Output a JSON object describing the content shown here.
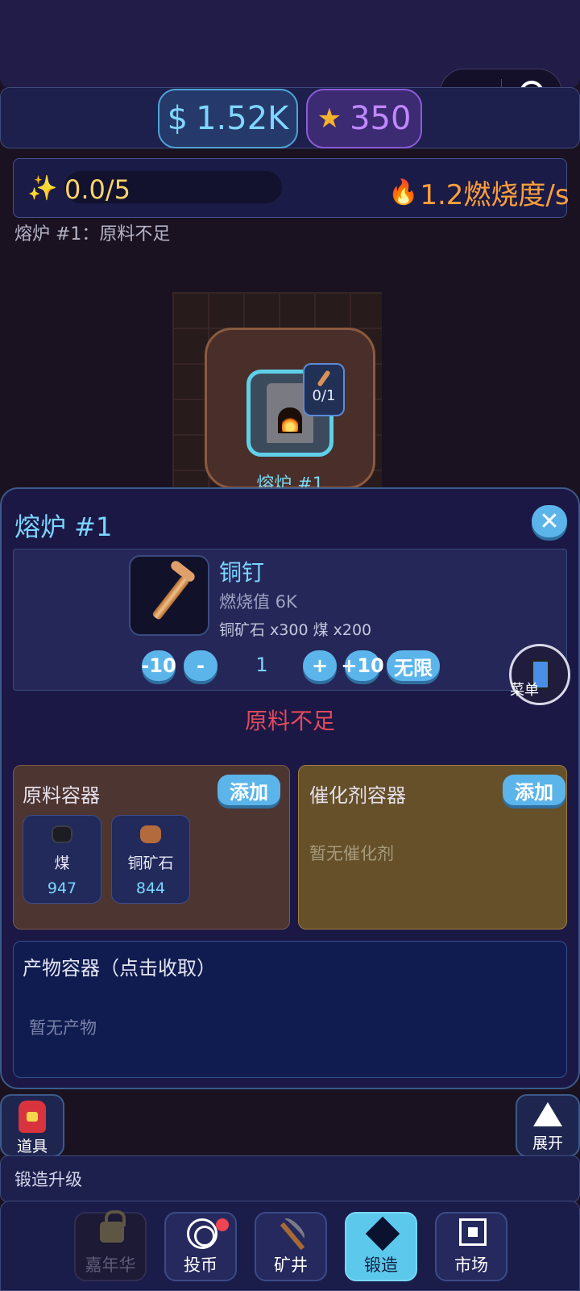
{
  "header": {
    "money": "1.52K",
    "money_symbol": "$",
    "stars": "350",
    "capsule_more": "•••"
  },
  "progress": {
    "value_text": "0.0/5",
    "fraction": 0.0,
    "burn_rate": "1.2燃烧度/s"
  },
  "status_text": "熔炉 #1：原料不足",
  "scene": {
    "furnace_label": "熔炉 #1",
    "mini_slot_count": "0/1"
  },
  "panel": {
    "title": "熔炉 #1",
    "close_label": "✕",
    "recipe": {
      "name": "铜钉",
      "burn_value": "燃烧值 6K",
      "cost": "铜矿石 x300  煤 x200"
    },
    "quantity": {
      "minus10": "-10",
      "minus": "-",
      "value": "1",
      "plus": "+",
      "plus10": "+10",
      "unlimited": "无限"
    },
    "menu_label": "菜单",
    "warning": "原料不足",
    "raw_container": {
      "title": "原料容器",
      "add_label": "添加",
      "items": [
        {
          "name": "煤",
          "count": "947",
          "color": "#1b1d22"
        },
        {
          "name": "铜矿石",
          "count": "844",
          "color": "#b36a3c"
        }
      ]
    },
    "catalyst_container": {
      "title": "催化剂容器",
      "add_label": "添加",
      "empty": "暂无催化剂"
    },
    "product_container": {
      "title": "产物容器（点击收取）",
      "empty": "暂无产物"
    }
  },
  "bottom": {
    "bag_label": "道具",
    "expand_label": "展开",
    "upgrade_label": "锻造升级"
  },
  "nav": [
    {
      "label": "嘉年华",
      "state": "disabled"
    },
    {
      "label": "投币",
      "state": "normal"
    },
    {
      "label": "矿井",
      "state": "normal"
    },
    {
      "label": "锻造",
      "state": "active"
    },
    {
      "label": "市场",
      "state": "normal"
    }
  ]
}
